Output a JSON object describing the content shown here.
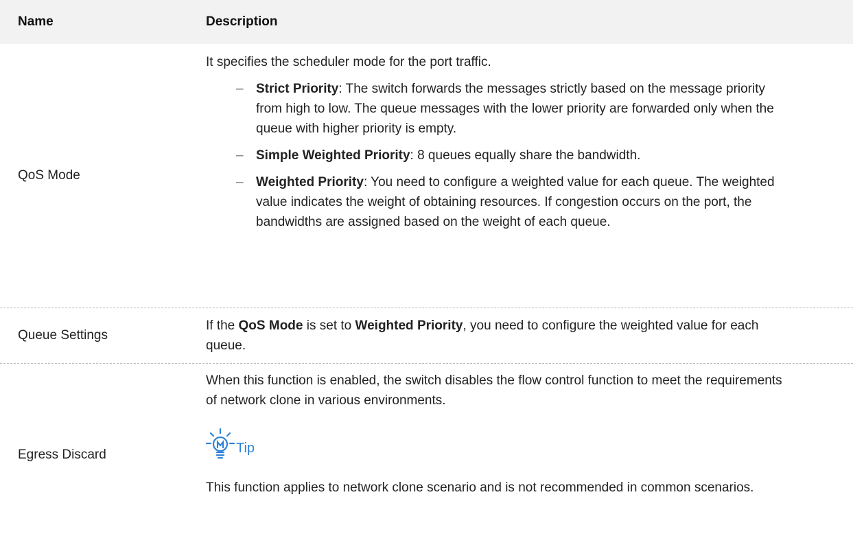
{
  "table": {
    "headers": {
      "name": "Name",
      "description": "Description"
    },
    "rows": {
      "qos_mode": {
        "name": "QoS Mode",
        "intro": "It specifies the scheduler mode for the port traffic.",
        "bullets": [
          {
            "dash": "–",
            "term": "Strict Priority",
            "text": ": The switch forwards the messages strictly based on the message priority from high to low. The queue messages with the lower priority are forwarded only when the queue with higher priority is empty."
          },
          {
            "dash": "–",
            "term": "Simple Weighted Priority",
            "text": ": 8 queues equally share the bandwidth."
          },
          {
            "dash": "–",
            "term": "Weighted Priority",
            "text": ": You need to configure a weighted value for each queue. The weighted value indicates the weight of obtaining resources. If congestion occurs on the port, the bandwidths are assigned based on the weight of each queue."
          }
        ]
      },
      "queue_settings": {
        "name": "Queue Settings",
        "parts": [
          "If the ",
          "QoS Mode",
          " is set to ",
          "Weighted Priority",
          ", you need to configure the weighted value for each queue."
        ]
      },
      "egress_discard": {
        "name": "Egress Discard",
        "intro": "When this function is enabled, the switch disables the flow control function to meet the requirements of network clone in various environments.",
        "tip_label": "Tip",
        "tip_icon": "lightbulb-icon",
        "tip_text": "This function applies to network clone scenario and is not recommended in common scenarios."
      }
    }
  },
  "colors": {
    "header_bg": "#f2f2f2",
    "tip_blue": "#2f83d6",
    "divider": "#bdbdbd"
  }
}
